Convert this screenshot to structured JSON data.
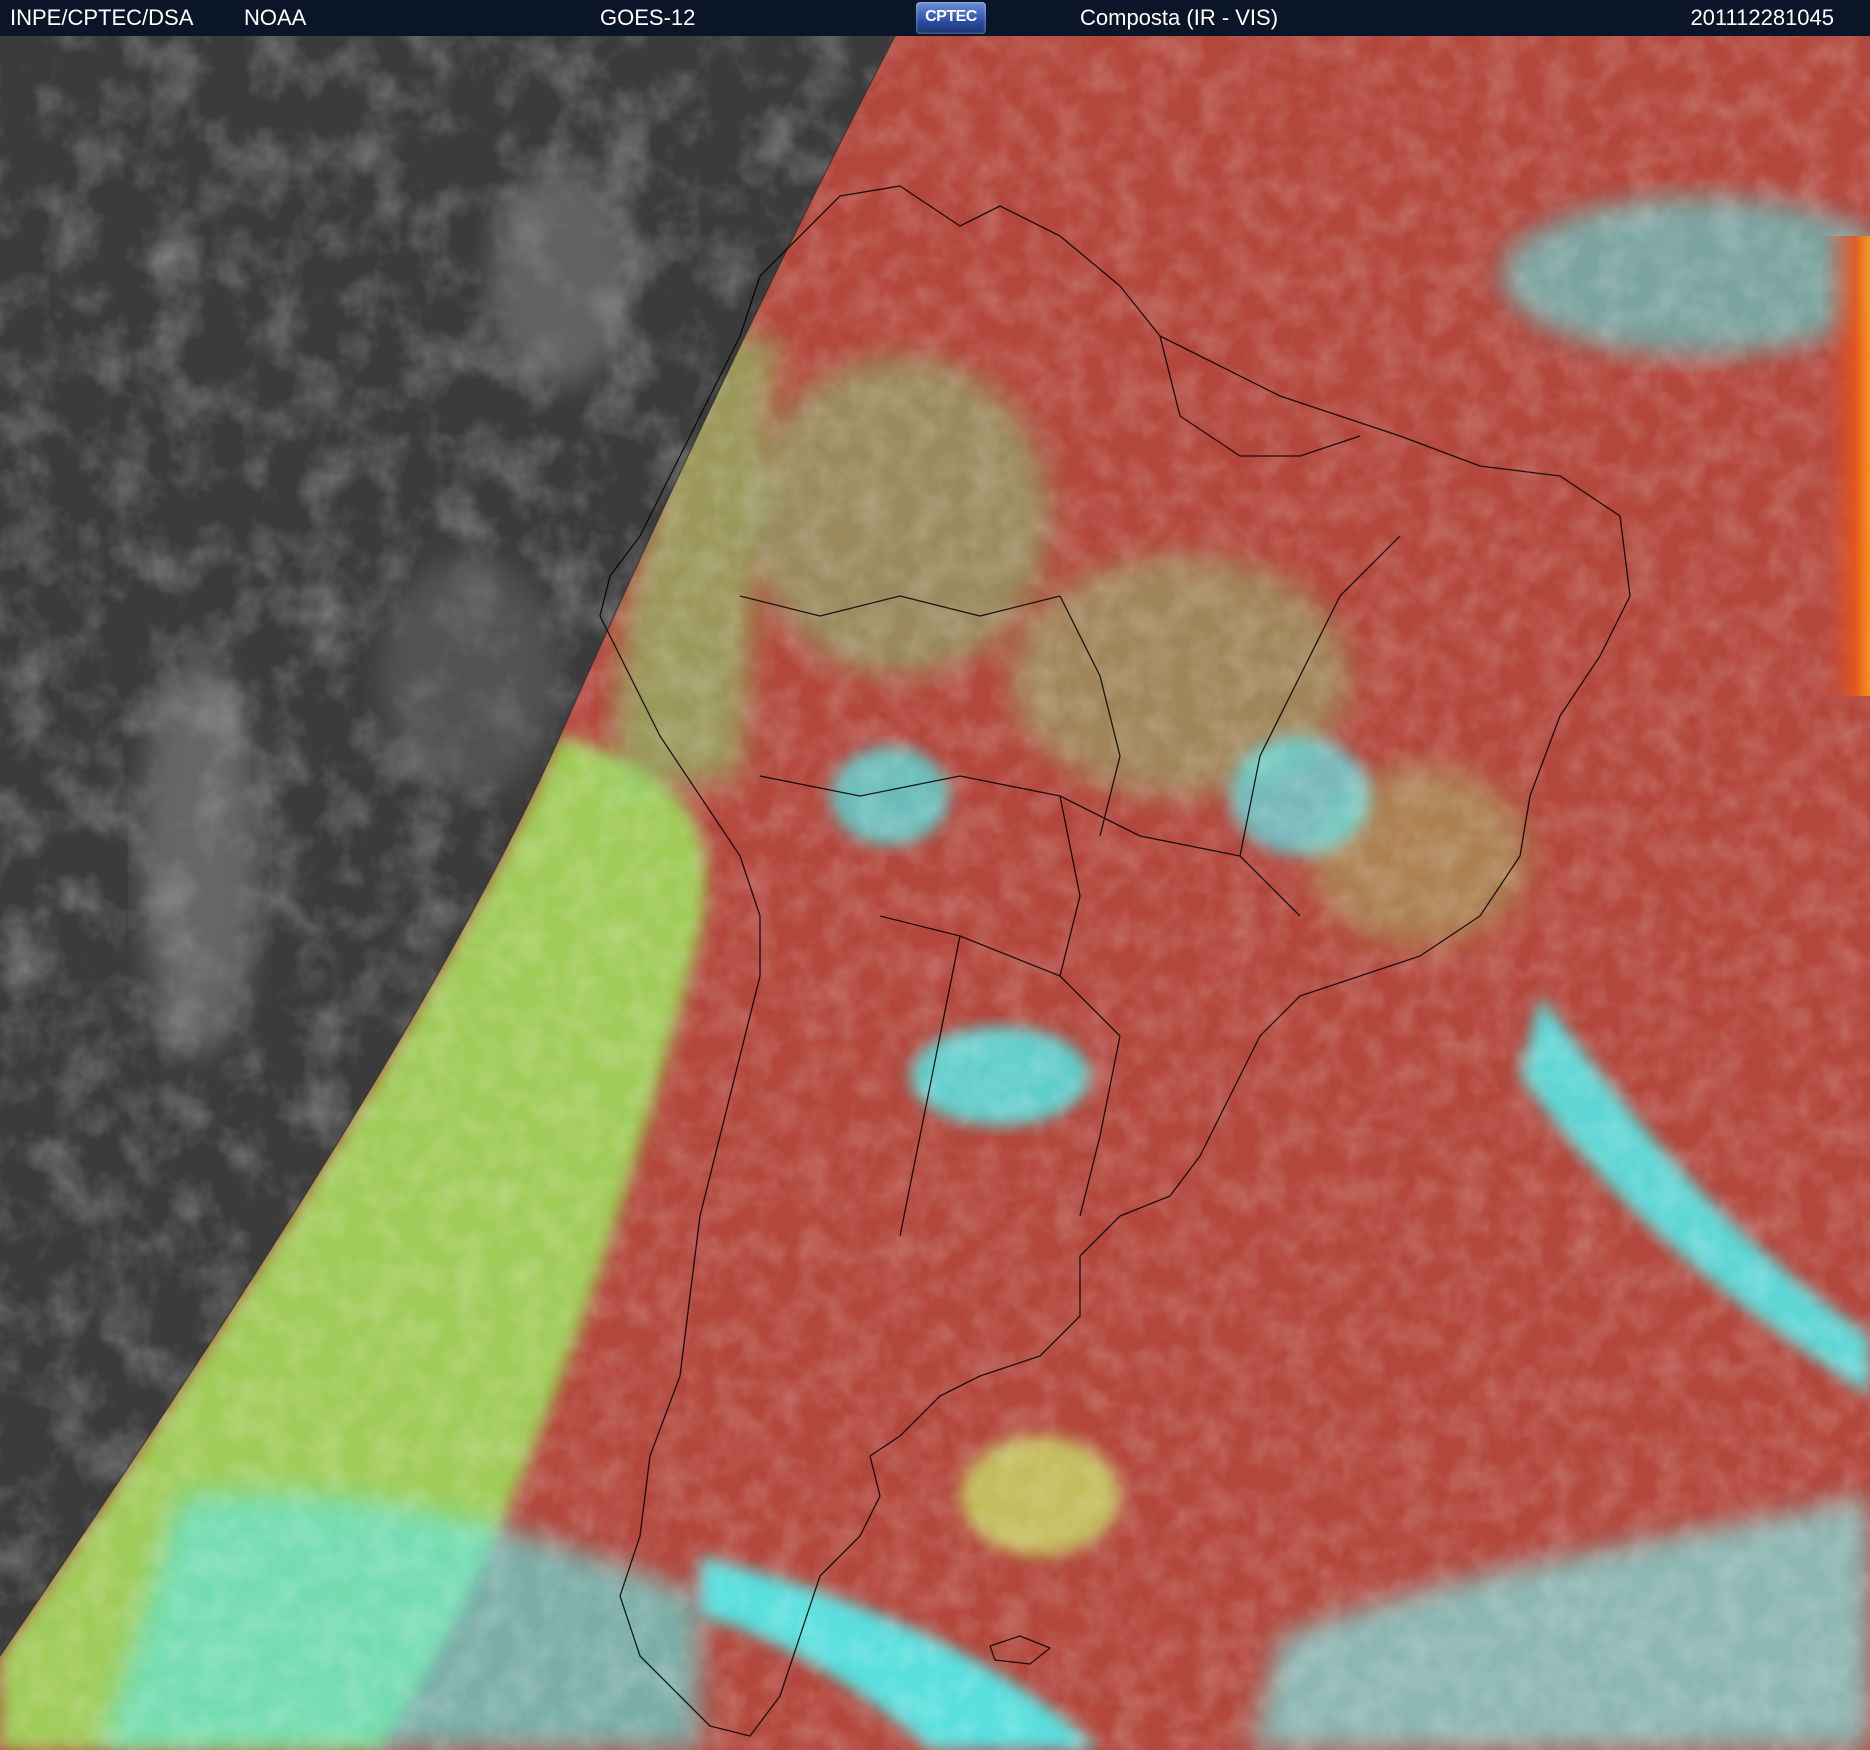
{
  "header": {
    "source": "INPE/CPTEC/DSA",
    "agency": "NOAA",
    "satellite": "GOES-12",
    "logo_text": "CPTEC",
    "product": "Composta (IR - VIS)",
    "timestamp": "201112281045"
  },
  "colors": {
    "header_bg": "#0a1628",
    "night_gray": "#3a3a3a",
    "clear_surface_red": "#b4483e",
    "low_cloud_green": "#9ad65a",
    "high_cloud_cyan": "#4ff0f0",
    "coastline": "#000000"
  }
}
